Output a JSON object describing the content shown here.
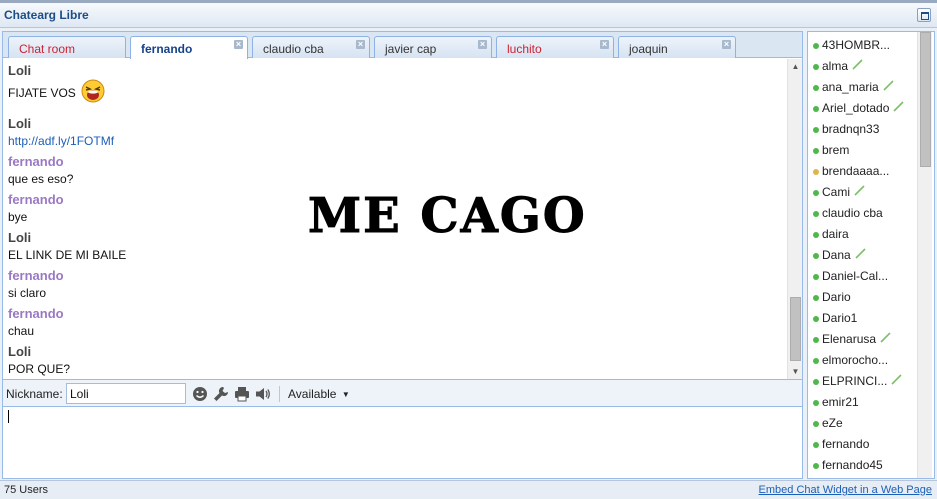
{
  "window": {
    "title": "Chatearg Libre"
  },
  "tabs": [
    {
      "label": "Chat room",
      "closable": false,
      "active": false,
      "color": "#cc2233"
    },
    {
      "label": "fernando",
      "closable": true,
      "active": true
    },
    {
      "label": "claudio cba",
      "closable": true,
      "active": false
    },
    {
      "label": "javier cap",
      "closable": true,
      "active": false
    },
    {
      "label": "luchito",
      "closable": true,
      "active": false,
      "color": "#cc2233"
    },
    {
      "label": "joaquin",
      "closable": true,
      "active": false
    }
  ],
  "messages": [
    {
      "author": "Loli",
      "text": "FIJATE VOS",
      "emoji": "laughing-face-icon"
    },
    {
      "author": "Loli",
      "link": "http://adf.ly/1FOTMf"
    },
    {
      "author": "fernando",
      "text": "que es eso?"
    },
    {
      "author": "fernando",
      "text": "bye"
    },
    {
      "author": "Loli",
      "text": "EL LINK DE MI BAILE"
    },
    {
      "author": "fernando",
      "text": "si claro"
    },
    {
      "author": "fernando",
      "text": "chau"
    },
    {
      "author": "Loli",
      "text": "POR QUE?"
    }
  ],
  "overlay": {
    "text": "ME CAGO"
  },
  "toolbar": {
    "nickname_label": "Nickname:",
    "nickname_value": "Loli",
    "icons": [
      "smiley-icon",
      "wrench-icon",
      "printer-icon",
      "speaker-icon"
    ],
    "status": "Available"
  },
  "compose": {
    "value": ""
  },
  "statusbar": {
    "users_count": "75 Users",
    "embed_link": "Embed Chat Widget in a Web Page"
  },
  "users": [
    {
      "name": "43HOMBR...",
      "status": "online",
      "edit": false
    },
    {
      "name": "alma",
      "status": "online",
      "edit": true
    },
    {
      "name": "ana_maria",
      "status": "online",
      "edit": true
    },
    {
      "name": "Ariel_dotado",
      "status": "online",
      "edit": true
    },
    {
      "name": "bradnqn33",
      "status": "online",
      "edit": false
    },
    {
      "name": "brem",
      "status": "online",
      "edit": false
    },
    {
      "name": "brendaaaa...",
      "status": "away",
      "edit": false
    },
    {
      "name": "Cami",
      "status": "online",
      "edit": true
    },
    {
      "name": "claudio cba",
      "status": "online",
      "edit": false
    },
    {
      "name": "daira",
      "status": "online",
      "edit": false
    },
    {
      "name": "Dana",
      "status": "online",
      "edit": true
    },
    {
      "name": "Daniel-Cal...",
      "status": "online",
      "edit": false
    },
    {
      "name": "Dario",
      "status": "online",
      "edit": false
    },
    {
      "name": "Dario1",
      "status": "online",
      "edit": false
    },
    {
      "name": "Elenarusa",
      "status": "online",
      "edit": true
    },
    {
      "name": "elmorocho...",
      "status": "online",
      "edit": false
    },
    {
      "name": "ELPRINCI...",
      "status": "online",
      "edit": true
    },
    {
      "name": "emir21",
      "status": "online",
      "edit": false
    },
    {
      "name": "eZe",
      "status": "online",
      "edit": false
    },
    {
      "name": "fernando",
      "status": "online",
      "edit": false
    },
    {
      "name": "fernando45",
      "status": "online",
      "edit": false
    }
  ],
  "colors": {
    "accent": "#15428b",
    "link": "#1c5fb8",
    "author_other": "#9a78c3",
    "online": "#4fb84a",
    "away": "#e0b64a",
    "alert_tab": "#cc2233"
  }
}
